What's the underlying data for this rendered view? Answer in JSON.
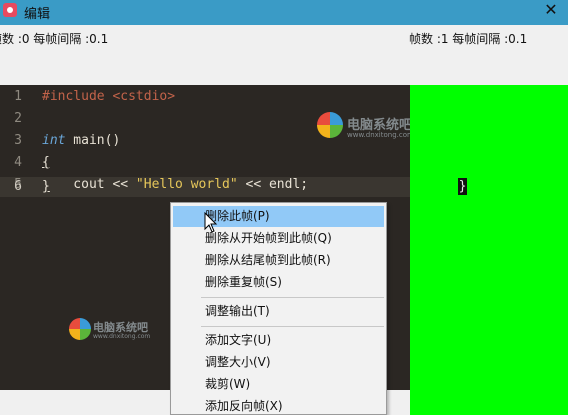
{
  "window": {
    "title": "编辑",
    "close_glyph": "✕"
  },
  "toolbar": {
    "left_info": "帧数 :0  每帧间隔 :0.1",
    "right_info": "帧数 :1  每帧间隔 :0.1"
  },
  "editor": {
    "line_numbers": [
      "1",
      "2",
      "3",
      "4",
      "5",
      "6"
    ],
    "lines": [
      {
        "segments": [
          {
            "cls": "kw-pre",
            "text": "#include <cstdio>"
          }
        ]
      },
      {
        "segments": []
      },
      {
        "segments": [
          {
            "cls": "kw-type",
            "text": "int"
          },
          {
            "cls": "fn",
            "text": " main()"
          }
        ]
      },
      {
        "segments": [
          {
            "cls": "bracket",
            "text": "{"
          }
        ]
      },
      {
        "segments": [
          {
            "cls": "fn",
            "text": "    cout << "
          },
          {
            "cls": "str",
            "text": "\"Hello world\""
          },
          {
            "cls": "fn",
            "text": " << endl;"
          }
        ]
      },
      {
        "segments": [
          {
            "cls": "bracket",
            "text": "}"
          }
        ]
      }
    ]
  },
  "preview": {
    "cursor_char": "}"
  },
  "watermark": {
    "text": "电脑系统吧",
    "sub": "www.dnxitong.com"
  },
  "context_menu": {
    "items": [
      {
        "label": "删除此帧(P)",
        "highlighted": true
      },
      {
        "label": "删除从开始帧到此帧(Q)",
        "highlighted": false
      },
      {
        "label": "删除从结尾帧到此帧(R)",
        "highlighted": false
      },
      {
        "label": "删除重复帧(S)",
        "highlighted": false
      },
      {
        "label": "调整输出(T)",
        "highlighted": false
      },
      {
        "label": "添加文字(U)",
        "highlighted": false
      },
      {
        "label": "调整大小(V)",
        "highlighted": false
      },
      {
        "label": "裁剪(W)",
        "highlighted": false
      },
      {
        "label": "添加反向帧(X)",
        "highlighted": false
      }
    ]
  },
  "colors": {
    "titlebar": "#3a9bc6",
    "editor_bg": "#2b2723",
    "preview_bg": "#00ff00",
    "menu_highlight": "#91c9f7"
  }
}
